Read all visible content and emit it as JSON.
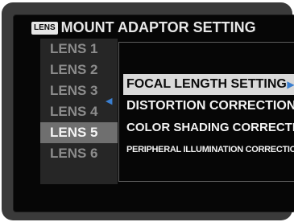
{
  "header": {
    "lens_icon": "LENS",
    "title": "MOUNT ADAPTOR SETTING"
  },
  "lens_list": {
    "items": [
      "LENS 1",
      "LENS 2",
      "LENS 3",
      "LENS 4",
      "LENS 5",
      "LENS 6"
    ],
    "selected_index": 4
  },
  "submenu": {
    "items": [
      "FOCAL LENGTH SETTING",
      "DISTORTION CORRECTION",
      "COLOR SHADING CORRECTION",
      "PERIPHERAL ILLUMINATION CORRECTION"
    ],
    "selected_index": 0
  },
  "colors": {
    "accent_arrow": "#3a7fd0",
    "highlight": "#d9d9d9",
    "lens_selected": "#6f6f6f"
  },
  "icons": {
    "left_arrow": "triangle-left-icon",
    "right_arrow": "triangle-right-icon"
  }
}
